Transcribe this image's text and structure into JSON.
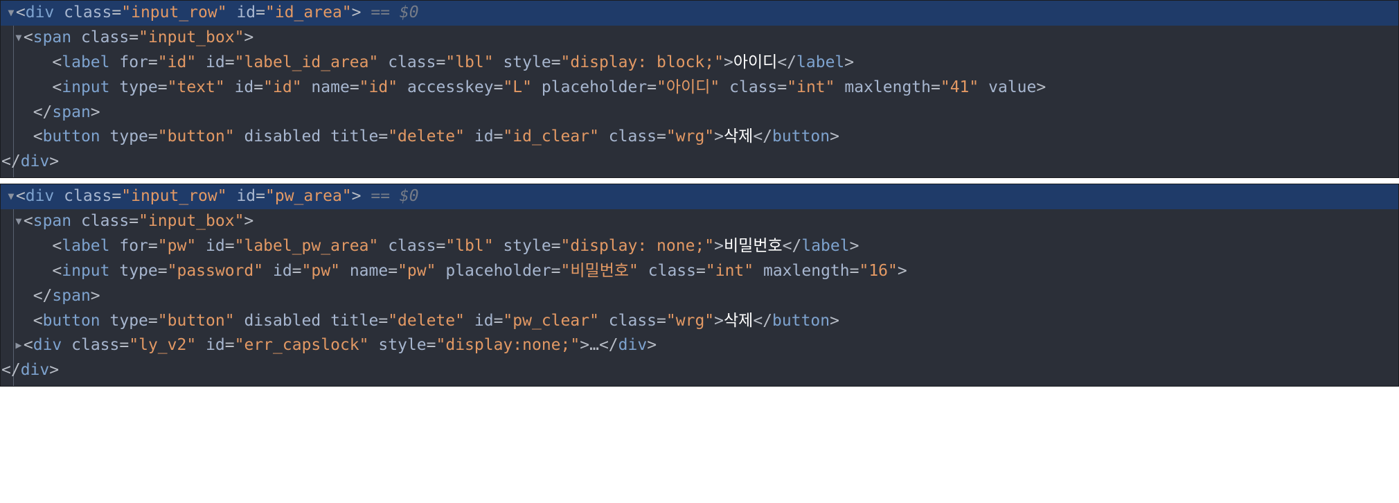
{
  "block1": {
    "hl": {
      "tag_open": "div",
      "attrs": [
        {
          "name": "class",
          "value": "input_row"
        },
        {
          "name": "id",
          "value": "id_area"
        }
      ],
      "meta": "== $0"
    },
    "span_open": {
      "tag": "span",
      "attrs": [
        {
          "name": "class",
          "value": "input_box"
        }
      ]
    },
    "label": {
      "tag": "label",
      "attrs": [
        {
          "name": "for",
          "value": "id"
        },
        {
          "name": "id",
          "value": "label_id_area"
        },
        {
          "name": "class",
          "value": "lbl"
        },
        {
          "name": "style",
          "value": "display: block;"
        }
      ],
      "text": "아이디"
    },
    "input": {
      "tag": "input",
      "attrs": [
        {
          "name": "type",
          "value": "text"
        },
        {
          "name": "id",
          "value": "id"
        },
        {
          "name": "name",
          "value": "id"
        },
        {
          "name": "accesskey",
          "value": "L"
        },
        {
          "name": "placeholder",
          "value": "아이디"
        },
        {
          "name": "class",
          "value": "int"
        },
        {
          "name": "maxlength",
          "value": "41"
        }
      ],
      "bare_attr": "value"
    },
    "span_close": "span",
    "button": {
      "tag": "button",
      "attrs_pre": [
        {
          "name": "type",
          "value": "button"
        }
      ],
      "bare_attr": "disabled",
      "attrs_post": [
        {
          "name": "title",
          "value": "delete"
        },
        {
          "name": "id",
          "value": "id_clear"
        },
        {
          "name": "class",
          "value": "wrg"
        }
      ],
      "text": "삭제"
    },
    "div_close": "div"
  },
  "block2": {
    "hl": {
      "tag_open": "div",
      "attrs": [
        {
          "name": "class",
          "value": "input_row"
        },
        {
          "name": "id",
          "value": "pw_area"
        }
      ],
      "meta": "== $0"
    },
    "span_open": {
      "tag": "span",
      "attrs": [
        {
          "name": "class",
          "value": "input_box"
        }
      ]
    },
    "label": {
      "tag": "label",
      "attrs": [
        {
          "name": "for",
          "value": "pw"
        },
        {
          "name": "id",
          "value": "label_pw_area"
        },
        {
          "name": "class",
          "value": "lbl"
        },
        {
          "name": "style",
          "value": "display: none;"
        }
      ],
      "text": "비밀번호"
    },
    "input": {
      "tag": "input",
      "attrs": [
        {
          "name": "type",
          "value": "password"
        },
        {
          "name": "id",
          "value": "pw"
        },
        {
          "name": "name",
          "value": "pw"
        },
        {
          "name": "placeholder",
          "value": "비밀번호"
        },
        {
          "name": "class",
          "value": "int"
        },
        {
          "name": "maxlength",
          "value": "16"
        }
      ]
    },
    "span_close": "span",
    "button": {
      "tag": "button",
      "attrs_pre": [
        {
          "name": "type",
          "value": "button"
        }
      ],
      "bare_attr": "disabled",
      "attrs_post": [
        {
          "name": "title",
          "value": "delete"
        },
        {
          "name": "id",
          "value": "pw_clear"
        },
        {
          "name": "class",
          "value": "wrg"
        }
      ],
      "text": "삭제"
    },
    "err_div": {
      "tag": "div",
      "attrs": [
        {
          "name": "class",
          "value": "ly_v2"
        },
        {
          "name": "id",
          "value": "err_capslock"
        },
        {
          "name": "style",
          "value": "display:none;"
        }
      ],
      "ellipsis": "…"
    },
    "div_close": "div"
  }
}
